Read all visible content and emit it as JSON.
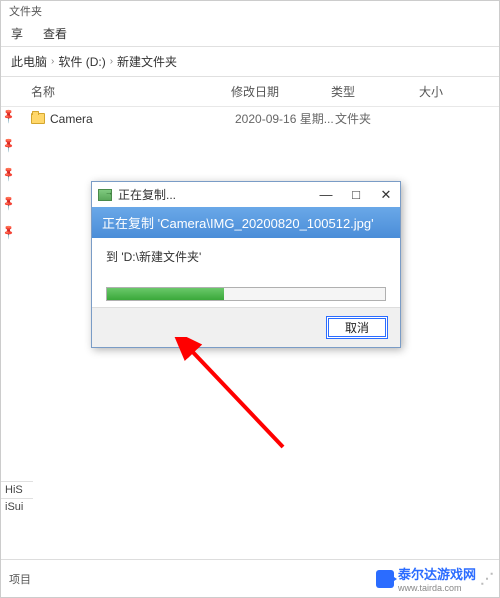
{
  "header": {
    "title": "文件夹"
  },
  "ribbon": {
    "share": "享",
    "view": "查看"
  },
  "breadcrumb": {
    "root": "此电脑",
    "drive": "软件 (D:)",
    "folder": "新建文件夹"
  },
  "columns": {
    "name": "名称",
    "date": "修改日期",
    "type": "类型",
    "size": "大小"
  },
  "rows": [
    {
      "name": "Camera",
      "date": "2020-09-16 星期...",
      "type": "文件夹",
      "size": ""
    }
  ],
  "sidebar": {
    "items": [
      "HiS",
      "iSui"
    ],
    "footer": "项目"
  },
  "dialog": {
    "title": "正在复制...",
    "banner": "正在复制 'Camera\\IMG_20200820_100512.jpg'",
    "dest_prefix": "到 ",
    "dest_path": "'D:\\新建文件夹'",
    "progress_pct": 42,
    "cancel": "取消",
    "min": "—",
    "max": "□",
    "close": "✕"
  },
  "watermark": {
    "brand": "泰尔达游戏网",
    "url": "www.tairda.com"
  }
}
